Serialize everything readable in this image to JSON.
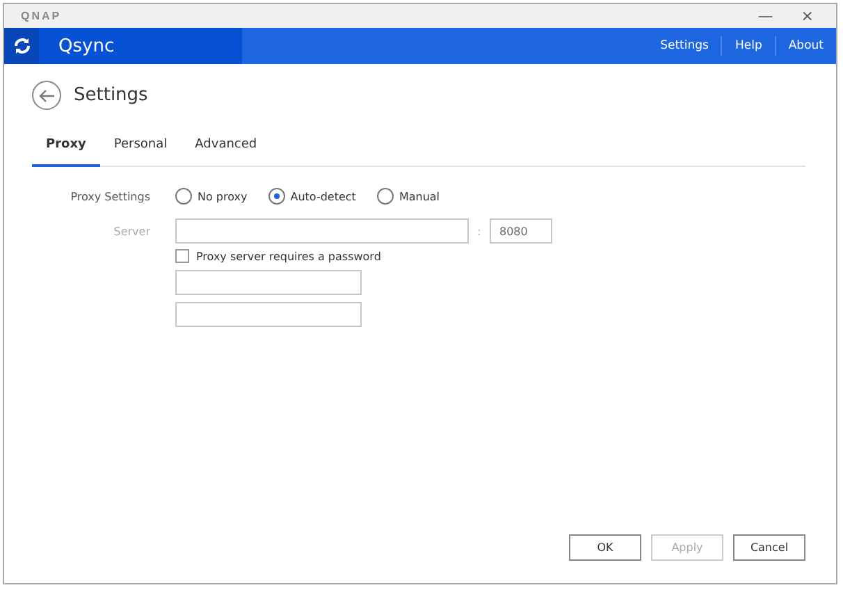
{
  "window": {
    "logo": "QNAP",
    "minimize": "—",
    "close": "×"
  },
  "header": {
    "app_name": "Qsync",
    "links": [
      {
        "label": "Settings"
      },
      {
        "label": "Help"
      },
      {
        "label": "About"
      }
    ]
  },
  "page": {
    "title": "Settings"
  },
  "tabs": [
    {
      "label": "Proxy",
      "selected": true
    },
    {
      "label": "Personal",
      "selected": false
    },
    {
      "label": "Advanced",
      "selected": false
    }
  ],
  "proxy_settings": {
    "label": "Proxy Settings",
    "options": [
      {
        "label": "No proxy",
        "selected": false
      },
      {
        "label": "Auto-detect",
        "selected": true
      },
      {
        "label": "Manual",
        "selected": false
      }
    ]
  },
  "server": {
    "label": "Server",
    "separator": ":",
    "port": "8080",
    "disabled": true
  },
  "password_checkbox": {
    "label": "Proxy server requires a password",
    "checked": false
  },
  "buttons": [
    {
      "label": "OK",
      "disabled": false
    },
    {
      "label": "Apply",
      "disabled": true
    },
    {
      "label": "Cancel",
      "disabled": false
    }
  ]
}
